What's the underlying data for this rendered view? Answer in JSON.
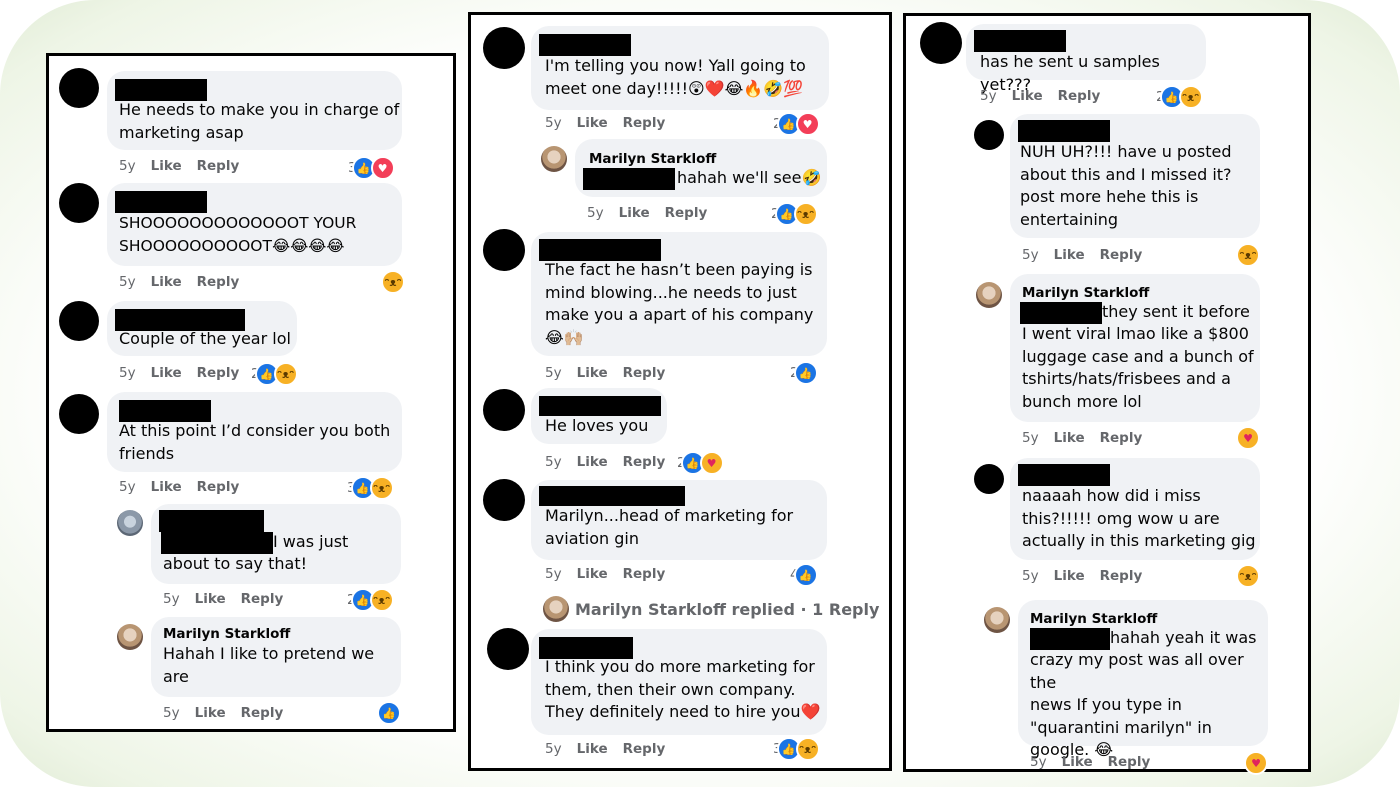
{
  "author_name": "Marilyn Starkloff",
  "time": "5y",
  "like_label": "Like",
  "reply_label": "Reply",
  "col1": [
    {
      "text": "He needs to make you in charge of\nmarketing asap",
      "count": "3"
    },
    {
      "text": "SHOOOOOOOOOOOOOT YOUR\nSHOOOOOOOOOOT😂😂😂😂",
      "count": ""
    },
    {
      "text": "Couple of the year lol",
      "count": "2"
    },
    {
      "text": "At this point I’d consider you both\nfriends",
      "count": "3"
    },
    {
      "text": "I was just",
      "text2": "about to say that!",
      "count": "2"
    },
    {
      "text": "Hahah I like to pretend we\nare",
      "count": ""
    }
  ],
  "col2": [
    {
      "text": "I'm telling you now! Yall going to\nmeet one day!!!!!😲❤️😂🔥🤣💯",
      "count": "2"
    },
    {
      "text": "hahah we'll see🤣",
      "count": "2"
    },
    {
      "text": "The fact he hasn’t been paying is\nmind blowing...he needs to just\nmake you a apart of his company\n😂🙌🏼",
      "count": "2"
    },
    {
      "text": "He loves you",
      "count": "2"
    },
    {
      "text": "Marilyn...head of marketing for\naviation gin",
      "count": "4"
    },
    {
      "text": "I think you do more marketing for\nthem, then their own company.\nThey definitely need to hire you❤️",
      "count": "3"
    }
  ],
  "col2_replied": "Marilyn Starkloff replied · 1 Reply",
  "col3": [
    {
      "text": "has he sent u samples yet???",
      "count": "2"
    },
    {
      "text": "NUH UH?!!! have u posted\nabout this and I missed it?\npost more hehe this is\nentertaining",
      "count": ""
    },
    {
      "text": "they sent it before",
      "text2": "I went viral lmao like a $800\nluggage case and a bunch of\ntshirts/hats/frisbees and a\nbunch more lol",
      "count": ""
    },
    {
      "text": "naaaah how did i miss\nthis?!!!!! omg wow u are\nactually in this marketing gig",
      "count": ""
    },
    {
      "text": "hahah yeah it was",
      "text2": "crazy my post was all over the\nnews If you type in\n\"quarantini marilyn\" in\ngoogle. 😂",
      "count": ""
    }
  ],
  "icons": {
    "like": "like-icon",
    "love": "love-icon",
    "haha": "haha-icon",
    "care": "care-icon"
  }
}
